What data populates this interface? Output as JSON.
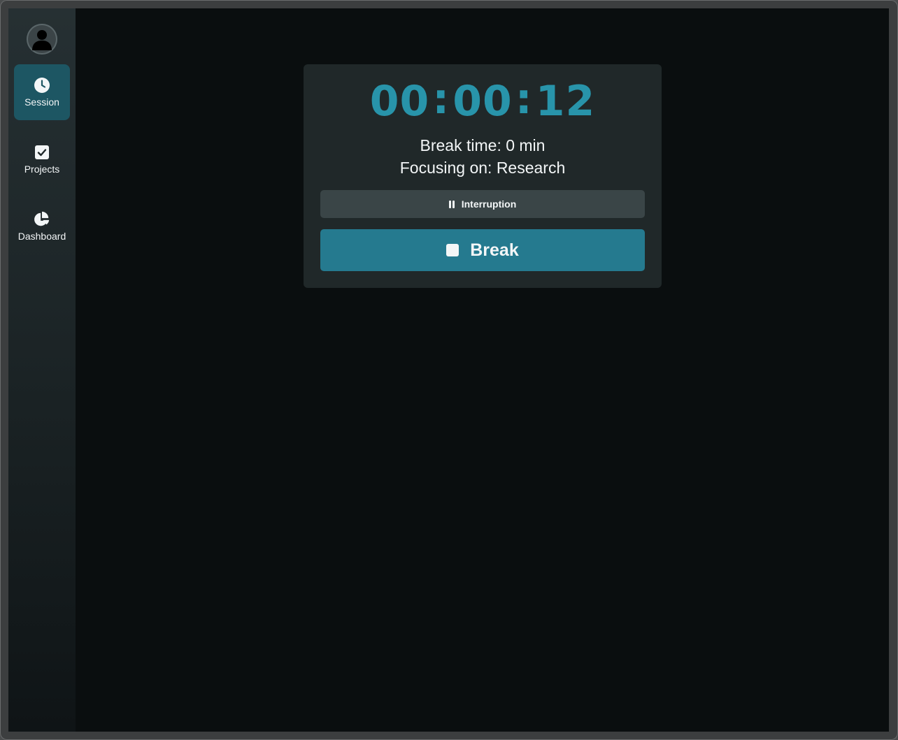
{
  "sidebar": {
    "avatar_icon": "user-avatar-icon",
    "items": [
      {
        "label": "Session",
        "icon": "clock-icon",
        "active": true
      },
      {
        "label": "Projects",
        "icon": "checkbox-icon",
        "active": false
      },
      {
        "label": "Dashboard",
        "icon": "pie-chart-icon",
        "active": false
      }
    ]
  },
  "session": {
    "timer": {
      "hours": "00",
      "minutes": "00",
      "seconds": "12",
      "separator": ":"
    },
    "break_time": "Break time: 0 min",
    "focusing_on": "Focusing on: Research",
    "interruption_label": "Interruption",
    "interruption_icon": "pause-icon",
    "break_label": "Break",
    "break_icon": "stop-icon"
  },
  "colors": {
    "accent": "#2894aa",
    "button_primary": "#257a8f",
    "sidebar_active": "#1d5663",
    "card_bg": "#202829",
    "page_bg": "#0a0e0f"
  }
}
